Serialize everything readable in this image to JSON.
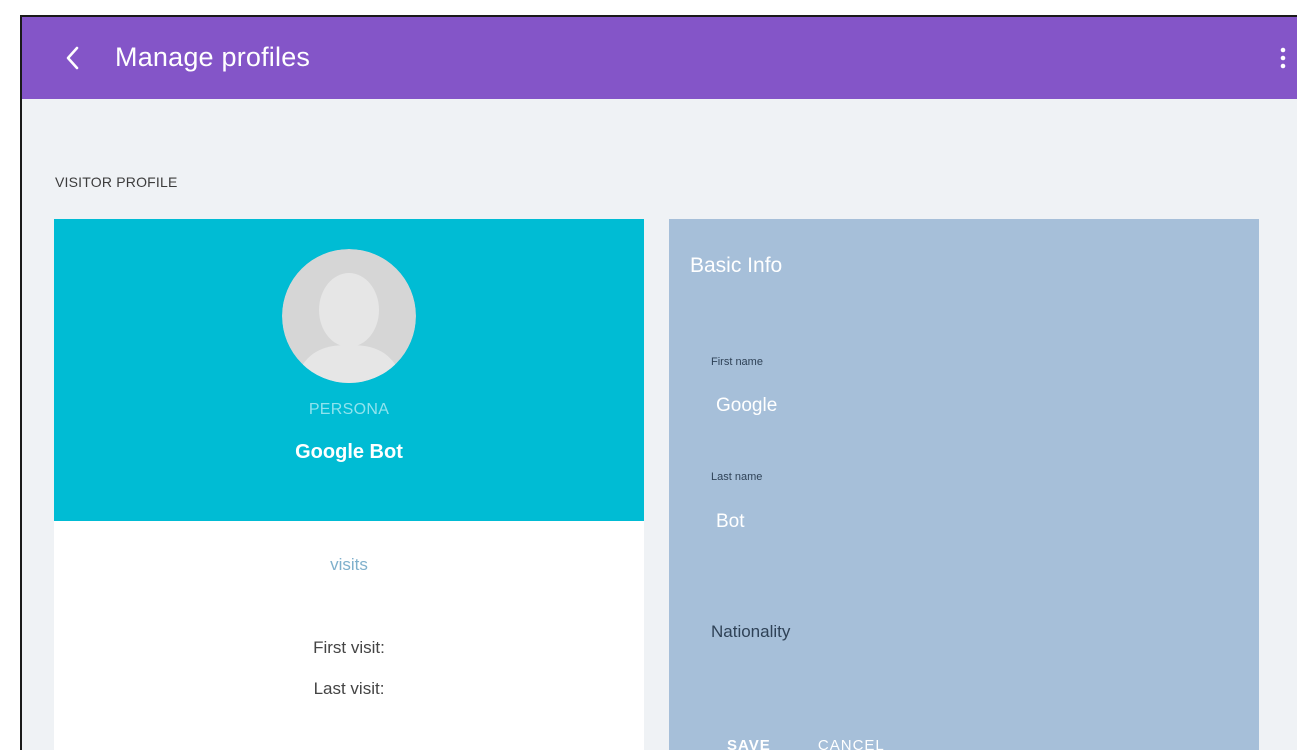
{
  "appbar": {
    "title": "Manage profiles",
    "back_icon": "chevron-left-icon",
    "more_icon": "more-vert-icon",
    "color": "#8455c8"
  },
  "section": {
    "title": "VISITOR PROFILE"
  },
  "profile": {
    "header_color": "#00bcd4",
    "avatar_icon": "default-avatar-icon",
    "persona_label": "PERSONA",
    "name": "Google Bot",
    "visits_label": "visits",
    "first_visit_label": "First visit:",
    "last_visit_label": "Last visit:"
  },
  "basic_info": {
    "title": "Basic Info",
    "card_color": "#a6bfd9",
    "first_name_label": "First name",
    "first_name_value": "Google",
    "last_name_label": "Last name",
    "last_name_value": "Bot",
    "nationality_label": "Nationality",
    "save_label": "SAVE",
    "cancel_label": "CANCEL"
  }
}
